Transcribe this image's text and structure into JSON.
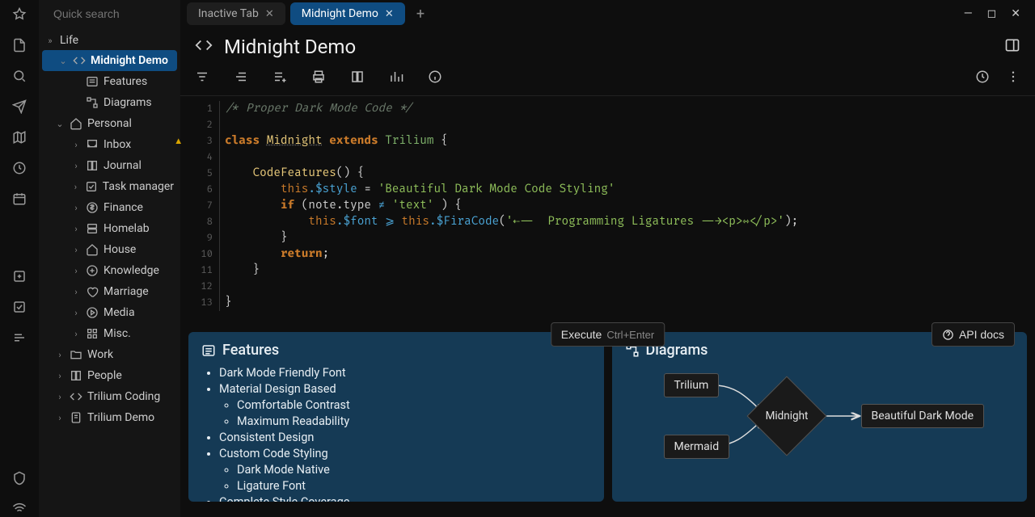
{
  "search": {
    "placeholder": "Quick search"
  },
  "tree": {
    "root": "Life",
    "selected": "Midnight Demo",
    "children": [
      {
        "label": "Features",
        "icon": "list"
      },
      {
        "label": "Diagrams",
        "icon": "diagram"
      }
    ],
    "personal": {
      "label": "Personal",
      "items": [
        "Inbox",
        "Journal",
        "Task manager",
        "Finance",
        "Homelab",
        "House",
        "Knowledge",
        "Marriage",
        "Media",
        "Misc."
      ]
    },
    "other": [
      "Work",
      "People",
      "Trilium Coding",
      "Trilium Demo"
    ]
  },
  "tabs": {
    "inactive": "Inactive Tab",
    "active": "Midnight Demo"
  },
  "title": "Midnight Demo",
  "buttons": {
    "execute": "Execute",
    "execute_hint": "Ctrl+Enter",
    "api": "API docs"
  },
  "code": {
    "lines": [
      "comment:/* Proper Dark Mode Code */",
      "",
      "classdecl",
      "",
      "fnhdr",
      "stylestr",
      "ifline",
      "fontline",
      "closebrace2",
      "returnline",
      "closebrace1",
      "",
      "closebrace0"
    ],
    "comment": "/* Proper Dark Mode Code */",
    "classword": "class",
    "classname": "Midnight",
    "extends": "extends",
    "supercls": "Trilium",
    "fnname": "CodeFeatures",
    "thisword": "this",
    "styleprop": ".$style",
    "stylestr": "'Beautiful Dark Mode Code Styling'",
    "ifkw": "if",
    "noteexpr": "(note.type",
    "neq": "≠",
    "textstr": "'text'",
    "fontprop": ".$font",
    "geq": "⩾",
    "firaprop": ".$FiraCode",
    "firaarg": "'⇠⸺  Programming Ligatures ⸺→<p>⇿</p>'",
    "returnkw": "return"
  },
  "features": {
    "title": "Features",
    "items": [
      "Dark Mode Friendly Font",
      "Material Design Based",
      [
        "Comfortable Contrast",
        "Maximum Readability"
      ],
      "Consistent Design",
      "Custom Code Styling",
      [
        "Dark Mode Native",
        "Ligature Font"
      ],
      "Complete Style Coverage"
    ]
  },
  "diagrams": {
    "title": "Diagrams",
    "nodes": {
      "a": "Trilium",
      "b": "Mermaid",
      "c": "Midnight",
      "d": "Beautiful Dark Mode"
    }
  }
}
